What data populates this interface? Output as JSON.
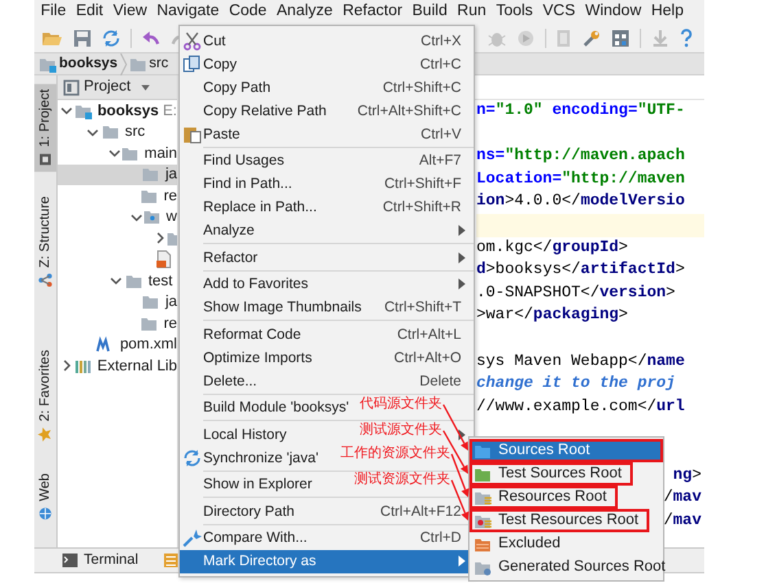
{
  "menubar": [
    "File",
    "Edit",
    "View",
    "Navigate",
    "Code",
    "Analyze",
    "Refactor",
    "Build",
    "Run",
    "Tools",
    "VCS",
    "Window",
    "Help"
  ],
  "breadcrumb": [
    {
      "label": "booksys",
      "kind": "module"
    },
    {
      "label": "src",
      "kind": "folder"
    }
  ],
  "tool_stripe": {
    "top": [
      {
        "label": "1: Project",
        "selected": true
      },
      {
        "label": "Z: Structure",
        "selected": false
      }
    ],
    "bottom": [
      {
        "label": "2: Favorites",
        "selected": false
      },
      {
        "label": "Web",
        "selected": false
      }
    ]
  },
  "project_panel": {
    "title": "Project",
    "tree": [
      {
        "label": "booksys",
        "path": "E:",
        "kind": "module",
        "expanded": true,
        "selected": false,
        "children": [
          {
            "label": "src",
            "kind": "folder",
            "expanded": true,
            "selected": false,
            "children": [
              {
                "label": "main",
                "kind": "folder",
                "expanded": true,
                "selected": false,
                "children": [
                  {
                    "label": "ja",
                    "kind": "folder",
                    "selected": true
                  },
                  {
                    "label": "re",
                    "kind": "folder",
                    "selected": false
                  },
                  {
                    "label": "w",
                    "kind": "web-folder",
                    "expanded": true,
                    "selected": false,
                    "children": [
                      {
                        "kind": "folder",
                        "expanded": false,
                        "selected": false
                      },
                      {
                        "kind": "web-file",
                        "selected": false
                      }
                    ]
                  }
                ]
              },
              {
                "label": "test",
                "kind": "folder",
                "expanded": true,
                "selected": false,
                "children": [
                  {
                    "label": "ja",
                    "kind": "folder",
                    "selected": false
                  },
                  {
                    "label": "re",
                    "kind": "folder",
                    "selected": false
                  }
                ]
              }
            ]
          },
          {
            "label": "pom.xml",
            "kind": "maven-file",
            "selected": false
          }
        ]
      },
      {
        "label": "External Lib",
        "kind": "libraries",
        "expanded": false,
        "selected": false
      }
    ]
  },
  "editor": {
    "lines": [
      {
        "segments": [
          {
            "kind": "attr",
            "text": "n="
          },
          {
            "kind": "str",
            "text": "\"1.0\""
          },
          {
            "kind": "attr",
            "text": " encoding="
          },
          {
            "kind": "str",
            "text": "\"UTF-"
          }
        ]
      },
      {
        "kind": "blank"
      },
      {
        "segments": [
          {
            "kind": "attr",
            "text": "ns="
          },
          {
            "kind": "str",
            "text": "\"http://maven.apach"
          }
        ]
      },
      {
        "segments": [
          {
            "kind": "attr",
            "text": "Location="
          },
          {
            "kind": "str",
            "text": "\"http://maven"
          }
        ]
      },
      {
        "segments": [
          {
            "kind": "tag",
            "text": "ion"
          },
          {
            "kind": "text",
            "text": ">4.0.0</"
          },
          {
            "kind": "tag",
            "text": "modelVersio"
          }
        ]
      },
      {
        "kind": "blank",
        "current": true
      },
      {
        "segments": [
          {
            "kind": "text",
            "text": "om.kgc</"
          },
          {
            "kind": "tag",
            "text": "groupId"
          },
          {
            "kind": "text",
            "text": ">"
          }
        ]
      },
      {
        "segments": [
          {
            "kind": "tag",
            "text": "d"
          },
          {
            "kind": "text",
            "text": ">booksys</"
          },
          {
            "kind": "tag",
            "text": "artifactId"
          },
          {
            "kind": "text",
            "text": ">"
          }
        ]
      },
      {
        "segments": [
          {
            "kind": "text",
            "text": ".0-SNAPSHOT</"
          },
          {
            "kind": "tag",
            "text": "version"
          },
          {
            "kind": "text",
            "text": ">"
          }
        ]
      },
      {
        "segments": [
          {
            "kind": "text",
            "text": ">war</"
          },
          {
            "kind": "tag",
            "text": "packaging"
          },
          {
            "kind": "text",
            "text": ">"
          }
        ]
      },
      {
        "kind": "blank"
      },
      {
        "segments": [
          {
            "kind": "text",
            "text": "sys Maven Webapp</"
          },
          {
            "kind": "tag",
            "text": "name"
          }
        ]
      },
      {
        "segments": [
          {
            "kind": "comment",
            "text": "change it to the proj"
          }
        ]
      },
      {
        "segments": [
          {
            "kind": "text",
            "text": "//www.example.com</"
          },
          {
            "kind": "tag",
            "text": "url"
          }
        ]
      },
      {
        "kind": "blank"
      },
      {
        "kind": "blank"
      },
      {
        "segments": [
          {
            "kind": "tag",
            "text": "ng"
          },
          {
            "kind": "text",
            "text": ">"
          }
        ],
        "tail": true
      },
      {
        "segments": [
          {
            "kind": "text",
            "text": "/"
          },
          {
            "kind": "tag",
            "text": "mav"
          }
        ],
        "tail": true
      },
      {
        "segments": [
          {
            "kind": "text",
            "text": "/"
          },
          {
            "kind": "tag",
            "text": "mav"
          }
        ],
        "tail": true
      }
    ]
  },
  "context_menu": {
    "items": [
      {
        "kind": "item",
        "label": "Cut",
        "shortcut": "Ctrl+X",
        "submenu": false,
        "selected": false
      },
      {
        "kind": "item",
        "label": "Copy",
        "shortcut": "Ctrl+C",
        "submenu": false,
        "selected": false
      },
      {
        "kind": "item",
        "label": "Copy Path",
        "shortcut": "Ctrl+Shift+C",
        "submenu": false,
        "selected": false
      },
      {
        "kind": "item",
        "label": "Copy Relative Path",
        "shortcut": "Ctrl+Alt+Shift+C",
        "submenu": false,
        "selected": false
      },
      {
        "kind": "item",
        "label": "Paste",
        "shortcut": "Ctrl+V",
        "submenu": false,
        "selected": false
      },
      {
        "kind": "separator"
      },
      {
        "kind": "item",
        "label": "Find Usages",
        "shortcut": "Alt+F7",
        "submenu": false,
        "selected": false
      },
      {
        "kind": "item",
        "label": "Find in Path...",
        "shortcut": "Ctrl+Shift+F",
        "submenu": false,
        "selected": false
      },
      {
        "kind": "item",
        "label": "Replace in Path...",
        "shortcut": "Ctrl+Shift+R",
        "submenu": false,
        "selected": false
      },
      {
        "kind": "item",
        "label": "Analyze",
        "submenu": true,
        "selected": false
      },
      {
        "kind": "separator"
      },
      {
        "kind": "item",
        "label": "Refactor",
        "submenu": true,
        "selected": false
      },
      {
        "kind": "separator"
      },
      {
        "kind": "item",
        "label": "Add to Favorites",
        "submenu": true,
        "selected": false
      },
      {
        "kind": "item",
        "label": "Show Image Thumbnails",
        "shortcut": "Ctrl+Shift+T",
        "submenu": false,
        "selected": false
      },
      {
        "kind": "separator"
      },
      {
        "kind": "item",
        "label": "Reformat Code",
        "shortcut": "Ctrl+Alt+L",
        "submenu": false,
        "selected": false
      },
      {
        "kind": "item",
        "label": "Optimize Imports",
        "shortcut": "Ctrl+Alt+O",
        "submenu": false,
        "selected": false
      },
      {
        "kind": "item",
        "label": "Delete...",
        "shortcut": "Delete",
        "submenu": false,
        "selected": false
      },
      {
        "kind": "separator"
      },
      {
        "kind": "item",
        "label": "Build Module 'booksys'",
        "submenu": false,
        "selected": false
      },
      {
        "kind": "separator"
      },
      {
        "kind": "item",
        "label": "Local History",
        "submenu": true,
        "selected": false
      },
      {
        "kind": "item",
        "label": "Synchronize 'java'",
        "submenu": false,
        "selected": false
      },
      {
        "kind": "separator"
      },
      {
        "kind": "item",
        "label": "Show in Explorer",
        "submenu": false,
        "selected": false
      },
      {
        "kind": "separator"
      },
      {
        "kind": "item",
        "label": "Directory Path",
        "shortcut": "Ctrl+Alt+F12",
        "submenu": false,
        "selected": false
      },
      {
        "kind": "separator"
      },
      {
        "kind": "item",
        "label": "Compare With...",
        "shortcut": "Ctrl+D",
        "submenu": false,
        "selected": false
      },
      {
        "kind": "item",
        "label": "Mark Directory as",
        "submenu": true,
        "selected": true
      }
    ]
  },
  "submenu": {
    "items": [
      {
        "label": "Sources Root",
        "selected": true,
        "annotated": true
      },
      {
        "label": "Test Sources Root",
        "selected": false,
        "annotated": true
      },
      {
        "label": "Resources Root",
        "selected": false,
        "annotated": true
      },
      {
        "label": "Test Resources Root",
        "selected": false,
        "annotated": true
      },
      {
        "label": "Excluded",
        "selected": false,
        "annotated": false
      },
      {
        "label": "Generated Sources Root",
        "selected": false,
        "annotated": false
      }
    ]
  },
  "annotations": [
    {
      "text": "代码源文件夹"
    },
    {
      "text": "测试源文件夹"
    },
    {
      "text": "工作的资源文件夹"
    },
    {
      "text": "测试资源文件夹"
    }
  ],
  "bottom_bar": {
    "tabs": [
      {
        "label": "Terminal"
      }
    ]
  }
}
